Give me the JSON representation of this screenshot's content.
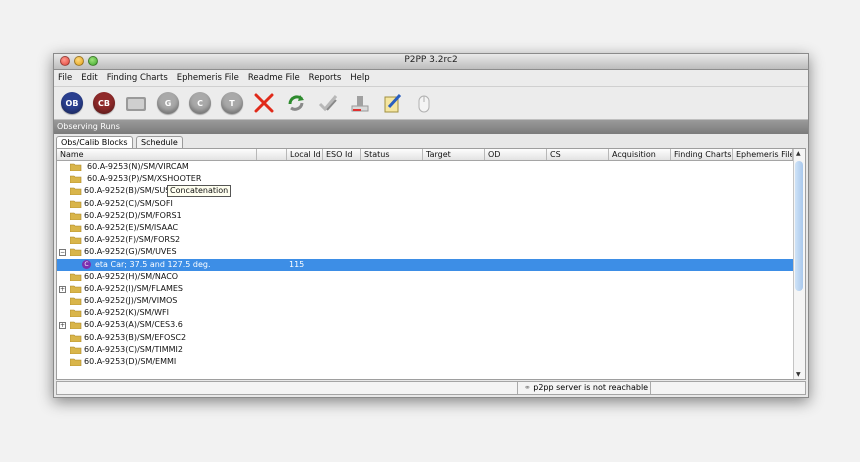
{
  "window": {
    "title": "P2PP 3.2rc2"
  },
  "menu": [
    "File",
    "Edit",
    "Finding Charts",
    "Ephemeris File",
    "Readme File",
    "Reports",
    "Help"
  ],
  "toolbar": [
    {
      "name": "ob-button",
      "label": "OB"
    },
    {
      "name": "cb-button",
      "label": "CB"
    },
    {
      "name": "folder-button",
      "label": ""
    },
    {
      "name": "g-button",
      "label": "G"
    },
    {
      "name": "c-button",
      "label": "C"
    },
    {
      "name": "t-button",
      "label": "T"
    },
    {
      "name": "delete-button",
      "label": ""
    },
    {
      "name": "refresh-button",
      "label": ""
    },
    {
      "name": "verify-button",
      "label": ""
    },
    {
      "name": "certify-button",
      "label": ""
    },
    {
      "name": "edit-button",
      "label": ""
    },
    {
      "name": "mouse-button",
      "label": ""
    }
  ],
  "section": {
    "title": "Observing Runs"
  },
  "tabs": [
    "Obs/Calib Blocks",
    "Schedule"
  ],
  "columns": [
    "Name",
    "",
    "Local Id",
    "ESO Id",
    "Status",
    "Target",
    "OD",
    "CS",
    "Acquisition",
    "Finding Charts",
    "Ephemeris File"
  ],
  "rows": [
    {
      "type": "folder",
      "label": "60.A-9253(N)/SM/VIRCAM",
      "expand": ""
    },
    {
      "type": "folder",
      "label": "60.A-9253(P)/SM/XSHOOTER",
      "expand": ""
    },
    {
      "type": "folder",
      "label": "60.A-9252(B)/SM/SUSI2",
      "expand": ""
    },
    {
      "type": "folder",
      "label": "60.A-9252(C)/SM/SOFI",
      "expand": ""
    },
    {
      "type": "folder",
      "label": "60.A-9252(D)/SM/FORS1",
      "expand": ""
    },
    {
      "type": "folder",
      "label": "60.A-9252(E)/SM/ISAAC",
      "expand": ""
    },
    {
      "type": "folder",
      "label": "60.A-9252(F)/SM/FORS2",
      "expand": ""
    },
    {
      "type": "folder",
      "label": "60.A-9252(G)/SM/UVES",
      "expand": "−"
    },
    {
      "type": "ob",
      "label": "eta Car; 37.5 and 127.5 deg.",
      "local_id": "115",
      "selected": true
    },
    {
      "type": "folder",
      "label": "60.A-9252(H)/SM/NACO",
      "expand": ""
    },
    {
      "type": "folder",
      "label": "60.A-9252(I)/SM/FLAMES",
      "expand": "+"
    },
    {
      "type": "folder",
      "label": "60.A-9252(J)/SM/VIMOS",
      "expand": ""
    },
    {
      "type": "folder",
      "label": "60.A-9252(K)/SM/WFI",
      "expand": ""
    },
    {
      "type": "folder",
      "label": "60.A-9253(A)/SM/CES3.6",
      "expand": "+"
    },
    {
      "type": "folder",
      "label": "60.A-9253(B)/SM/EFOSC2",
      "expand": ""
    },
    {
      "type": "folder",
      "label": "60.A-9253(C)/SM/TIMMI2",
      "expand": ""
    },
    {
      "type": "folder",
      "label": "60.A-9253(D)/SM/EMMI",
      "expand": ""
    }
  ],
  "tooltip": "Concatenation",
  "ob_icon_letter": "C",
  "status": "p2pp server is not reachable"
}
